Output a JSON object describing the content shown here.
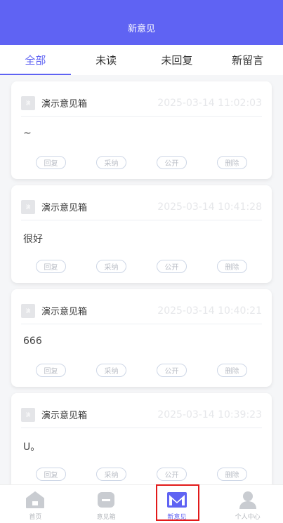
{
  "header": {
    "title": "新意见"
  },
  "tabs": [
    {
      "label": "全部",
      "active": true
    },
    {
      "label": "未读",
      "active": false
    },
    {
      "label": "未回复",
      "active": false
    },
    {
      "label": "新留言",
      "active": false
    }
  ],
  "cards": [
    {
      "avatar_text": "演",
      "name": "演示意见箱",
      "time": "2025-03-14 11:02:03",
      "content": "~",
      "actions": [
        "回复",
        "采纳",
        "公开",
        "删除"
      ]
    },
    {
      "avatar_text": "演",
      "name": "演示意见箱",
      "time": "2025-03-14 10:41:28",
      "content": "很好",
      "actions": [
        "回复",
        "采纳",
        "公开",
        "删除"
      ]
    },
    {
      "avatar_text": "演",
      "name": "演示意见箱",
      "time": "2025-03-14 10:40:21",
      "content": "666",
      "actions": [
        "回复",
        "采纳",
        "公开",
        "删除"
      ]
    },
    {
      "avatar_text": "演",
      "name": "演示意见箱",
      "time": "2025-03-14 10:39:23",
      "content": "U。",
      "actions": [
        "回复",
        "采纳",
        "公开",
        "删除"
      ]
    }
  ],
  "tabbar": [
    {
      "label": "首页",
      "icon": "home-icon",
      "active": false
    },
    {
      "label": "意见箱",
      "icon": "inbox-icon",
      "active": false
    },
    {
      "label": "新意见",
      "icon": "mail-icon",
      "active": true
    },
    {
      "label": "个人中心",
      "icon": "user-icon",
      "active": false
    }
  ],
  "colors": {
    "accent": "#5f63f3",
    "highlight_border": "#e21a1a"
  }
}
